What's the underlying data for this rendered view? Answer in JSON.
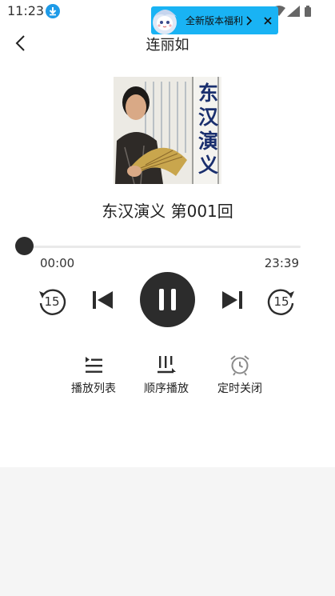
{
  "status_bar": {
    "time": "11:23",
    "download_icon": "download-icon",
    "icons": [
      "wifi-icon",
      "signal-icon",
      "battery-icon"
    ]
  },
  "promo_banner": {
    "text": "全新版本福利",
    "mascot_icon": "mascot-icon",
    "arrow_icon": "chevron-right-icon",
    "close_icon": "close-icon",
    "color": "#19b3f4"
  },
  "nav": {
    "back_icon": "back-arrow-icon",
    "title": "连丽如"
  },
  "album": {
    "cover_title": "东汉演义"
  },
  "track": {
    "title": "东汉演义 第001回"
  },
  "progress": {
    "current": "00:00",
    "total": "23:39",
    "fraction": 0
  },
  "controls": {
    "rewind": {
      "icon": "rewind-15-icon",
      "seconds": "15"
    },
    "previous": {
      "icon": "skip-previous-icon"
    },
    "play_pause": {
      "icon": "pause-icon",
      "state": "playing"
    },
    "next": {
      "icon": "skip-next-icon"
    },
    "forward": {
      "icon": "forward-15-icon",
      "seconds": "15"
    }
  },
  "tools": [
    {
      "label": "播放列表",
      "icon": "playlist-icon"
    },
    {
      "label": "顺序播放",
      "icon": "sequential-play-icon"
    },
    {
      "label": "定时关闭",
      "icon": "alarm-clock-icon"
    }
  ],
  "colors": {
    "dark": "#2c2c2c",
    "accent": "#1e9be8",
    "background": "#f5f5f5"
  }
}
